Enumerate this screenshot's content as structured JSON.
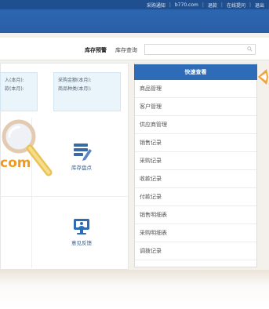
{
  "topbar": {
    "links": [
      "采购通知",
      "b770.com",
      "退款",
      "在线提问",
      "退出"
    ]
  },
  "toolbar": {
    "stock_alert_label": "库存预警",
    "stock_query_label": "库存查询",
    "search_placeholder": ""
  },
  "stats": {
    "left": [
      "入(本月):",
      "款(本月):"
    ],
    "right": [
      "采购金额(本月):",
      "商品种类(本月):"
    ]
  },
  "watermark": {
    "brand_text": "com"
  },
  "tiles": [
    {
      "label": "库存盘点",
      "icon": "inventory-check-icon"
    },
    {
      "label": "意见反馈",
      "icon": "feedback-icon"
    }
  ],
  "quick_panel": {
    "title": "快速查看",
    "items": [
      "商品管理",
      "客户管理",
      "供应商管理",
      "销售记录",
      "采购记录",
      "收款记录",
      "付款记录",
      "销售明细表",
      "采购明细表",
      "调拨记录"
    ]
  },
  "colors": {
    "topbar": "#1f4f8f",
    "navbar": "#2d66b0",
    "panel_head": "#2f6cb8",
    "brand_orange": "#f29a1d"
  }
}
